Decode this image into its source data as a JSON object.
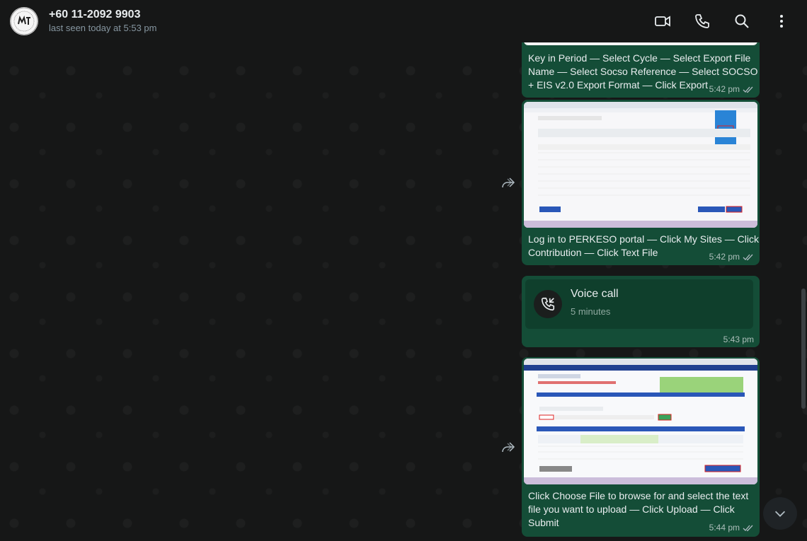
{
  "header": {
    "contact_name": "+60 11-2092 9903",
    "last_seen": "last seen today at 5:53 pm",
    "icons": [
      "video-call-icon",
      "voice-call-icon",
      "search-icon",
      "menu-icon"
    ]
  },
  "messages": [
    {
      "type": "image",
      "caption": "Key in Period — Select Cycle — Select Export File Name — Select Socso Reference — Select SOCSO + EIS v2.0 Export Format — Click Export",
      "time": "5:42 pm",
      "status": "read"
    },
    {
      "type": "image",
      "caption": "Log in to PERKESO portal — Click My Sites — Click Contribution — Click Text File",
      "time": "5:42 pm",
      "status": "read",
      "forwardable": true
    },
    {
      "type": "call",
      "title": "Voice call",
      "duration": "5 minutes",
      "time": "5:43 pm"
    },
    {
      "type": "image",
      "caption": "Click Choose File to browse for and select the text file you want to upload — Click Upload — Click Submit",
      "time": "5:44 pm",
      "status": "read",
      "forwardable": true
    }
  ],
  "colors": {
    "outgoing_bubble": "#144d37",
    "header": "#161717",
    "status_read": "#8696a0"
  }
}
